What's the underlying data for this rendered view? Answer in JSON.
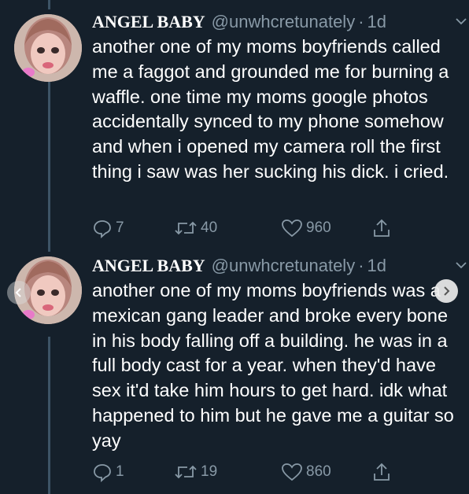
{
  "tweets": [
    {
      "display_name": "ANGEL BABY",
      "handle": "@unwhcretunately",
      "separator": "·",
      "time": "1d",
      "text": "another one of my moms boyfriends called me a faggot and grounded me for burning a waffle. one time my moms google photos accidentally synced to my phone somehow and when i opened my camera roll the first thing i saw was her sucking his dick. i cried.",
      "replies": "7",
      "retweets": "40",
      "likes": "960"
    },
    {
      "display_name": "ANGEL BABY",
      "handle": "@unwhcretunately",
      "separator": "·",
      "time": "1d",
      "text": "another one of my moms boyfriends was a mexican gang leader and broke every bone in his body falling off a building. he was in a full body cast for a year. when they'd have sex it'd take him hours to get hard. idk what happened to him but he gave me a guitar so yay",
      "replies": "1",
      "retweets": "19",
      "likes": "860"
    }
  ],
  "icons": {
    "reply": "speech-bubble-icon",
    "retweet": "retweet-arrows-icon",
    "like": "heart-icon",
    "share": "share-upload-icon",
    "more": "chevron-down-icon",
    "prev": "chevron-left-icon",
    "next": "chevron-right-icon"
  },
  "colors": {
    "background": "#15202b",
    "secondary_text": "#8899a6",
    "thread_line": "#3d5466"
  }
}
